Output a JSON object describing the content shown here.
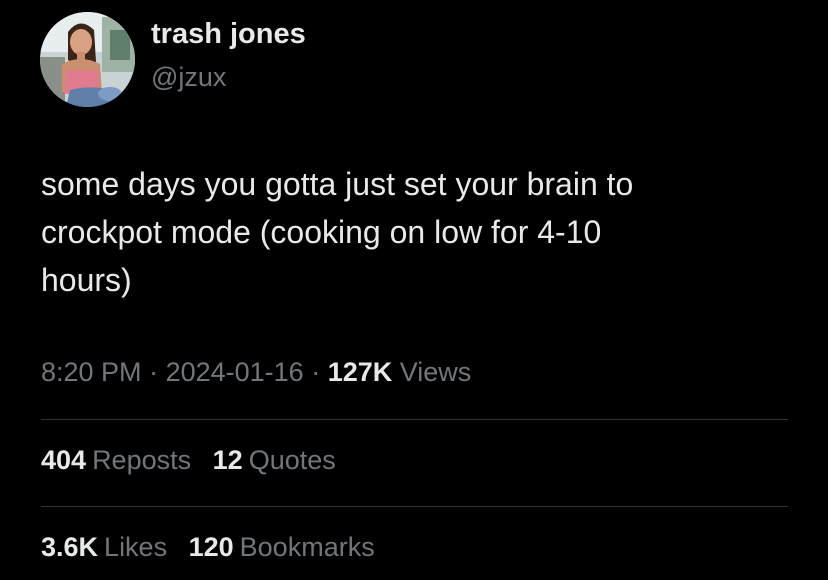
{
  "author": {
    "name": "trash jones",
    "handle": "@jzux"
  },
  "tweet": {
    "lines": [
      "some days you gotta just set your brain to",
      "crockpot mode (cooking on low for 4-10",
      "hours)"
    ]
  },
  "meta": {
    "time": "8:20 PM",
    "separator": " · ",
    "date": "2024-01-16",
    "views_count": "127K",
    "views_label": "Views"
  },
  "stats": {
    "reposts_count": "404",
    "reposts_label": "Reposts",
    "quotes_count": "12",
    "quotes_label": "Quotes",
    "likes_count": "3.6K",
    "likes_label": "Likes",
    "bookmarks_count": "120",
    "bookmarks_label": "Bookmarks"
  },
  "colors": {
    "background": "#000000",
    "primary_text": "#e7e9ea",
    "secondary_text": "#71767b",
    "divider": "#2f3336"
  }
}
